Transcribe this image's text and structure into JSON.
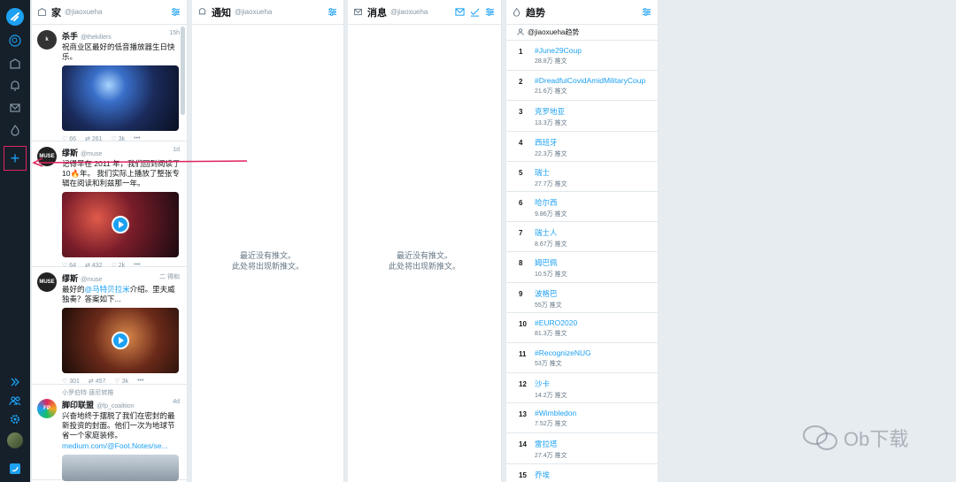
{
  "nav": {
    "items": [
      "logo-icon",
      "search-icon",
      "home-icon",
      "notifications-icon",
      "messages-icon",
      "trending-icon"
    ],
    "add_label": "+",
    "bottom": [
      "expand-icon",
      "accounts-icon",
      "settings-icon"
    ]
  },
  "home": {
    "title": "家",
    "user": "@jiaoxueha",
    "tweets": [
      {
        "avatar": "k",
        "name": "杀手",
        "handle": "@thekillers",
        "time": "15h",
        "text": "祝商业区最好的低音播放器生日快乐。",
        "replies": "66",
        "retweets": "261",
        "likes": "3k",
        "media": "concert"
      },
      {
        "avatar": "MUSE",
        "name": "缪斯",
        "handle": "@muse",
        "time": "1d",
        "text": "记得早在 2011 年，我们回到阅读了 10🔥年。 我们实际上播放了整张专辑在阅读和利兹那一年。",
        "replies": "64",
        "retweets": "432",
        "likes": "2k",
        "media": "video"
      },
      {
        "avatar": "MUSE",
        "name": "缪斯",
        "handle": "@muse",
        "time": "二 得和",
        "text_a": "最好的",
        "text_link": "@马特贝拉米",
        "text_b": "介绍。里夫威独奏？答案如下...",
        "replies": "301",
        "retweets": "457",
        "likes": "3k",
        "media": "video"
      },
      {
        "note": "小罗伯特·唐尼转推",
        "avatar": "FP",
        "name": "脚印联盟",
        "handle": "@fp_coalition",
        "time": "4d",
        "text": "兴奋地终于摆脱了我们在密封的最新投资的封面。他们一次为地球节省一个家庭装修。",
        "link": "medium.com/@Foot.Notes/se...",
        "media": "house"
      }
    ]
  },
  "notifications": {
    "title": "通知",
    "user": "@jiaoxueha",
    "empty_line1": "最近没有推文。",
    "empty_line2": "此处将出现新推文。"
  },
  "messages": {
    "title": "消息",
    "user": "@jiaoxueha",
    "empty_line1": "最近没有推文。",
    "empty_line2": "此处将出现新推文。"
  },
  "trends": {
    "title": "趋势",
    "location": "@jiaoxueha趋势",
    "items": [
      {
        "rank": "1",
        "name": "#June29Coup",
        "count": "28.8万 推文"
      },
      {
        "rank": "2",
        "name": "#DreadfulCovidAmidMilitaryCoup",
        "count": "21.6万 推文"
      },
      {
        "rank": "3",
        "name": "克罗地亚",
        "count": "13.3万 推文"
      },
      {
        "rank": "4",
        "name": "西班牙",
        "count": "22.3万 推文"
      },
      {
        "rank": "5",
        "name": "瑞士",
        "count": "27.7万 推文"
      },
      {
        "rank": "6",
        "name": "哈尔西",
        "count": "9.86万 推文"
      },
      {
        "rank": "7",
        "name": "瑞士人",
        "count": "8.67万 推文"
      },
      {
        "rank": "8",
        "name": "姆巴佩",
        "count": "10.5万 推文"
      },
      {
        "rank": "9",
        "name": "波格巴",
        "count": "55万 推文"
      },
      {
        "rank": "10",
        "name": "#EURO2020",
        "count": "81.3万 推文"
      },
      {
        "rank": "11",
        "name": "#RecognizeNUG",
        "count": "53万 推文"
      },
      {
        "rank": "12",
        "name": "沙卡",
        "count": "14.2万 推文"
      },
      {
        "rank": "13",
        "name": "#Wimbledon",
        "count": "7.52万 推文"
      },
      {
        "rank": "14",
        "name": "雷拉塔",
        "count": "27.4万 推文"
      },
      {
        "rank": "15",
        "name": "乔埃",
        "count": ""
      }
    ]
  },
  "watermark": "Ob下载",
  "colors": {
    "accent": "#1da1f2",
    "nav_bg": "#15202b",
    "highlight": "#e0245e"
  }
}
